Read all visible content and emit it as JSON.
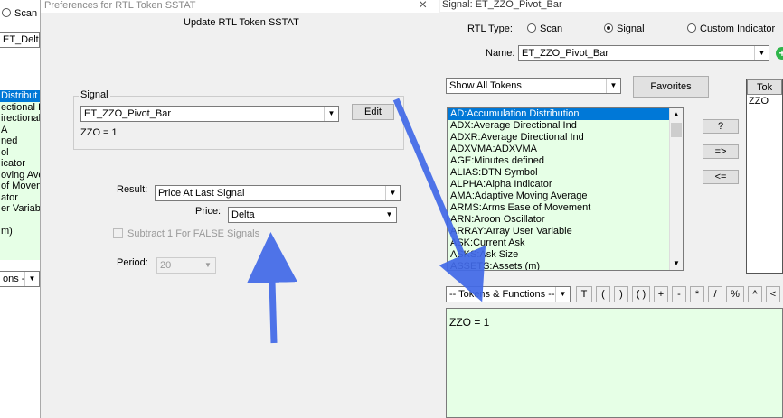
{
  "left_window": {
    "scan_radio": "Scan",
    "name_value": "ET_DeltaR",
    "list_items": [
      "Distribut",
      "ectional I",
      "irectional",
      "A",
      "ned",
      "ol",
      "icator",
      "oving Ave",
      "of Movem",
      "ator",
      "er Variabl",
      "",
      "m)"
    ],
    "tokens_combo": "ons --"
  },
  "pref_dialog": {
    "title": "Preferences for RTL Token SSTAT",
    "heading": "Update RTL Token SSTAT",
    "signal_group_label": "Signal",
    "signal_value": "ET_ZZO_Pivot_Bar",
    "edit_button": "Edit",
    "formula": "ZZO = 1",
    "result_label": "Result:",
    "result_value": "Price At Last Signal",
    "price_label": "Price:",
    "price_value": "Delta",
    "subtract_checkbox": "Subtract 1 For FALSE Signals",
    "period_label": "Period:",
    "period_value": "20",
    "close_icon": "×"
  },
  "signal_window": {
    "title": "Signal: ET_ZZO_Pivot_Bar",
    "rtl_type_label": "RTL Type:",
    "radio_scan": "Scan",
    "radio_signal": "Signal",
    "radio_custom": "Custom Indicator",
    "name_label": "Name:",
    "name_value": "ET_ZZO_Pivot_Bar",
    "show_combo": "Show All Tokens",
    "favorites_button": "Favorites",
    "token_list": [
      "AD:Accumulation Distribution",
      "ADX:Average Directional Ind",
      "ADXR:Average Directional Ind",
      "ADXVMA:ADXVMA",
      "AGE:Minutes defined",
      "ALIAS:DTN Symbol",
      "ALPHA:Alpha Indicator",
      "AMA:Adaptive Moving Average",
      "ARMS:Arms Ease of Movement",
      "ARN:Aroon Oscillator",
      "ARRAY:Array User Variable",
      "ASK:Current Ask",
      "ASKS:Ask Size",
      "ASSETS:Assets (m)"
    ],
    "help_button": "?",
    "add_button": "=>",
    "remove_button": "<=",
    "right_list_header": "Tok",
    "right_list_item": "ZZO",
    "tokens_functions_combo": "-- Tokens & Functions --",
    "toolbar_buttons": [
      "T",
      "(",
      ")",
      "( )",
      "+",
      "-",
      "*",
      "/",
      "%",
      "^",
      "<",
      "<="
    ],
    "formula_text": "ZZO = 1"
  },
  "colors": {
    "arrow": "#4169e8",
    "selection": "#0078d7",
    "list_bg": "#e6ffe6"
  }
}
